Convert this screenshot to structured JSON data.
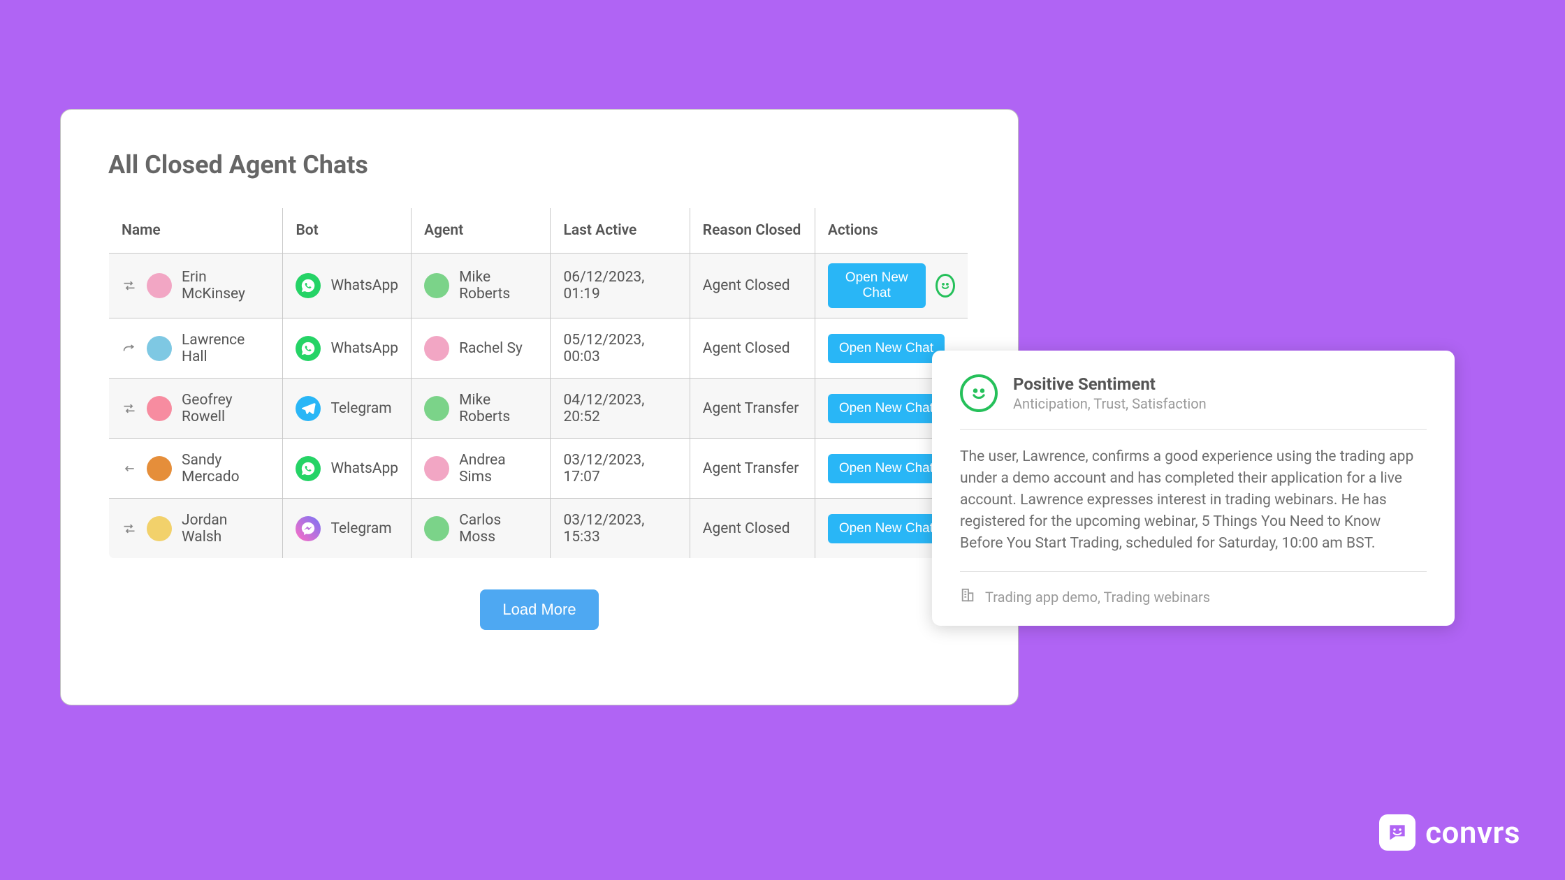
{
  "title": "All Closed Agent Chats",
  "columns": [
    "Name",
    "Bot",
    "Agent",
    "Last Active",
    "Reason Closed",
    "Actions"
  ],
  "rows": [
    {
      "row_icon": "shuffle",
      "name": "Erin McKinsey",
      "avatar_color": "#F2A6C4",
      "bot": "WhatsApp",
      "bot_kind": "whatsapp",
      "agent": "Mike Roberts",
      "agent_color": "#7BD389",
      "last_active": "06/12/2023, 01:19",
      "reason": "Agent Closed",
      "action_label": "Open New Chat",
      "has_sentiment_badge": true
    },
    {
      "row_icon": "forward",
      "name": "Lawrence Hall",
      "avatar_color": "#7EC8E3",
      "bot": "WhatsApp",
      "bot_kind": "whatsapp",
      "agent": "Rachel Sy",
      "agent_color": "#F2A6C4",
      "last_active": "05/12/2023, 00:03",
      "reason": "Agent Closed",
      "action_label": "Open New Chat",
      "has_sentiment_badge": false
    },
    {
      "row_icon": "shuffle",
      "name": "Geofrey Rowell",
      "avatar_color": "#F78CA0",
      "bot": "Telegram",
      "bot_kind": "telegram",
      "agent": "Mike Roberts",
      "agent_color": "#7BD389",
      "last_active": "04/12/2023, 20:52",
      "reason": "Agent Transfer",
      "action_label": "Open New Chat",
      "has_sentiment_badge": false
    },
    {
      "row_icon": "back",
      "name": "Sandy Mercado",
      "avatar_color": "#E58E3A",
      "bot": "WhatsApp",
      "bot_kind": "whatsapp",
      "agent": "Andrea Sims",
      "agent_color": "#F2A6C4",
      "last_active": "03/12/2023, 17:07",
      "reason": "Agent Transfer",
      "action_label": "Open New Chat",
      "has_sentiment_badge": false
    },
    {
      "row_icon": "shuffle",
      "name": "Jordan Walsh",
      "avatar_color": "#F2D16B",
      "bot": "Telegram",
      "bot_kind": "messenger",
      "agent": "Carlos Moss",
      "agent_color": "#7BD389",
      "last_active": "03/12/2023, 15:33",
      "reason": "Agent Closed",
      "action_label": "Open New Chat",
      "has_sentiment_badge": false
    }
  ],
  "load_more_label": "Load More",
  "popover": {
    "title": "Positive Sentiment",
    "subtitle": "Anticipation, Trust, Satisfaction",
    "body": "The user, Lawrence, confirms a good experience using the trading app under a demo account and has completed their application for a live account. Lawrence expresses interest in trading webinars. He has registered for the upcoming webinar, 5 Things You Need to Know Before You Start Trading, scheduled for Saturday, 10:00 am BST.",
    "tags": "Trading app demo, Trading webinars"
  },
  "brand": "convrs"
}
